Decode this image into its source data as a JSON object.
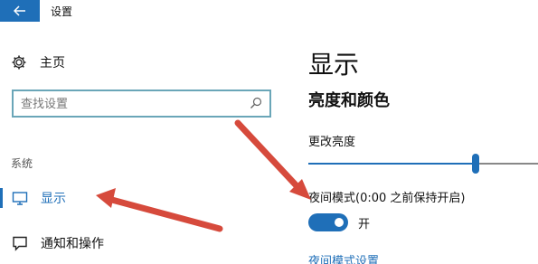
{
  "window": {
    "title": "设置"
  },
  "sidebar": {
    "home_label": "主页",
    "search": {
      "placeholder": "查找设置",
      "value": ""
    },
    "section_label": "系统",
    "items": [
      {
        "label": "显示",
        "icon": "monitor-icon",
        "active": true
      },
      {
        "label": "通知和操作",
        "icon": "notification-icon",
        "active": false
      }
    ]
  },
  "main": {
    "title": "显示",
    "section_heading": "亮度和颜色",
    "brightness": {
      "label": "更改亮度",
      "value_fraction": 0.73
    },
    "night_light": {
      "label": "夜间模式(0:00 之前保持开启)",
      "toggle_state": "开",
      "toggle_on": true,
      "settings_link": "夜间模式设置"
    }
  },
  "colors": {
    "accent": "#1f6fb8",
    "annotation_arrow": "#d64a3c"
  }
}
